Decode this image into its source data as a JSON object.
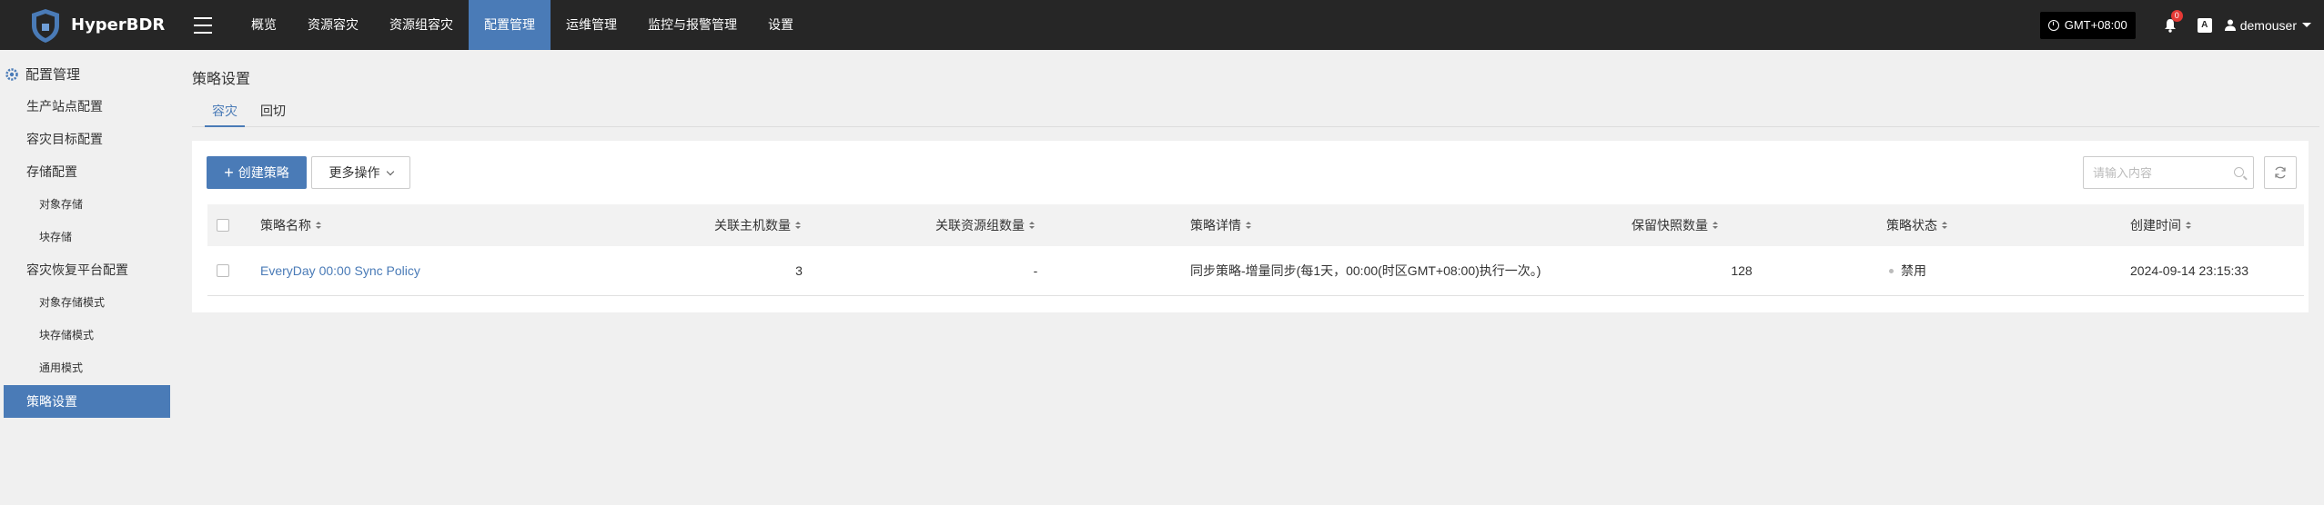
{
  "app": {
    "name": "HyperBDR"
  },
  "nav": {
    "items": [
      {
        "label": "概览",
        "active": false
      },
      {
        "label": "资源容灾",
        "active": false
      },
      {
        "label": "资源组容灾",
        "active": false
      },
      {
        "label": "配置管理",
        "active": true
      },
      {
        "label": "运维管理",
        "active": false
      },
      {
        "label": "监控与报警管理",
        "active": false
      },
      {
        "label": "设置",
        "active": false
      }
    ],
    "timezone": "GMT+08:00",
    "notification_count": "0",
    "lang_label": "A",
    "user": "demouser"
  },
  "sidebar": {
    "header": "配置管理",
    "items": [
      {
        "label": "生产站点配置"
      },
      {
        "label": "容灾目标配置"
      },
      {
        "label": "存储配置"
      },
      {
        "label": "对象存储"
      },
      {
        "label": "块存储"
      },
      {
        "label": "容灾恢复平台配置"
      },
      {
        "label": "对象存储模式"
      },
      {
        "label": "块存储模式"
      },
      {
        "label": "通用模式"
      },
      {
        "label": "策略设置"
      }
    ],
    "active": "策略设置"
  },
  "page": {
    "title": "策略设置",
    "tabs": [
      {
        "label": "容灾",
        "active": true
      },
      {
        "label": "回切",
        "active": false
      }
    ]
  },
  "toolbar": {
    "create_label": "创建策略",
    "more_label": "更多操作",
    "search_placeholder": "请输入内容"
  },
  "table": {
    "columns": [
      "策略名称",
      "关联主机数量",
      "关联资源组数量",
      "策略详情",
      "保留快照数量",
      "策略状态",
      "创建时间"
    ],
    "rows": [
      {
        "name": "EveryDay 00:00 Sync Policy",
        "hosts": "3",
        "groups": "-",
        "detail": "同步策略-增量同步(每1天，00:00(时区GMT+08:00)执行一次。)",
        "snapshots": "128",
        "status": "禁用",
        "created": "2024-09-14 23:15:33"
      }
    ]
  },
  "colors": {
    "accent": "#4a7bb7",
    "topbar": "#262626",
    "badge": "#e53935"
  }
}
